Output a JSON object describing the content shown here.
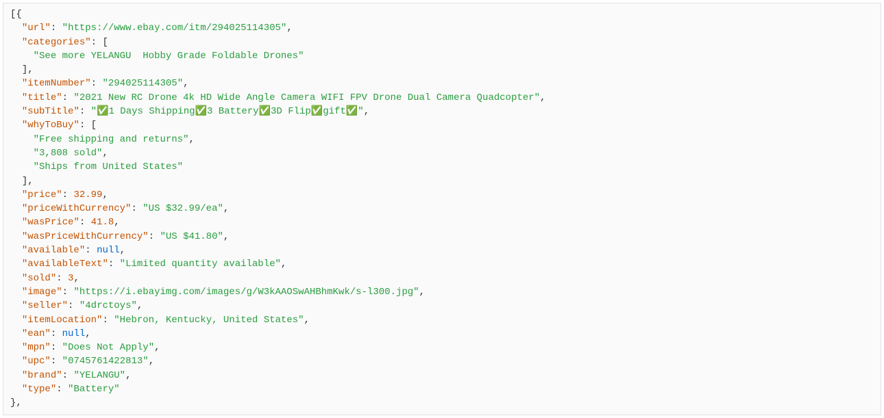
{
  "json": {
    "url": "https://www.ebay.com/itm/294025114305",
    "categories": [
      "See more YELANGU  Hobby Grade Foldable Drones"
    ],
    "itemNumber": "294025114305",
    "title": "2021 New RC Drone 4k HD Wide Angle Camera WIFI FPV Drone Dual Camera Quadcopter",
    "subTitle": "✅1 Days Shipping✅3 Battery✅3D Flip✅gift✅",
    "whyToBuy": [
      "Free shipping and returns",
      "3,808 sold",
      "Ships from United States"
    ],
    "price": 32.99,
    "priceWithCurrency": "US $32.99/ea",
    "wasPrice": 41.8,
    "wasPriceWithCurrency": "US $41.80",
    "available": null,
    "availableText": "Limited quantity available",
    "sold": 3,
    "image": "https://i.ebayimg.com/images/g/W3kAAOSwAHBhmKwk/s-l300.jpg",
    "seller": "4drctoys",
    "itemLocation": "Hebron, Kentucky, United States",
    "ean": null,
    "mpn": "Does Not Apply",
    "upc": "0745761422813",
    "brand": "YELANGU",
    "type": "Battery"
  },
  "keys": {
    "url": "url",
    "categories": "categories",
    "itemNumber": "itemNumber",
    "title": "title",
    "subTitle": "subTitle",
    "whyToBuy": "whyToBuy",
    "price": "price",
    "priceWithCurrency": "priceWithCurrency",
    "wasPrice": "wasPrice",
    "wasPriceWithCurrency": "wasPriceWithCurrency",
    "available": "available",
    "availableText": "availableText",
    "sold": "sold",
    "image": "image",
    "seller": "seller",
    "itemLocation": "itemLocation",
    "ean": "ean",
    "mpn": "mpn",
    "upc": "upc",
    "brand": "brand",
    "type": "type"
  },
  "literals": {
    "null": "null"
  }
}
